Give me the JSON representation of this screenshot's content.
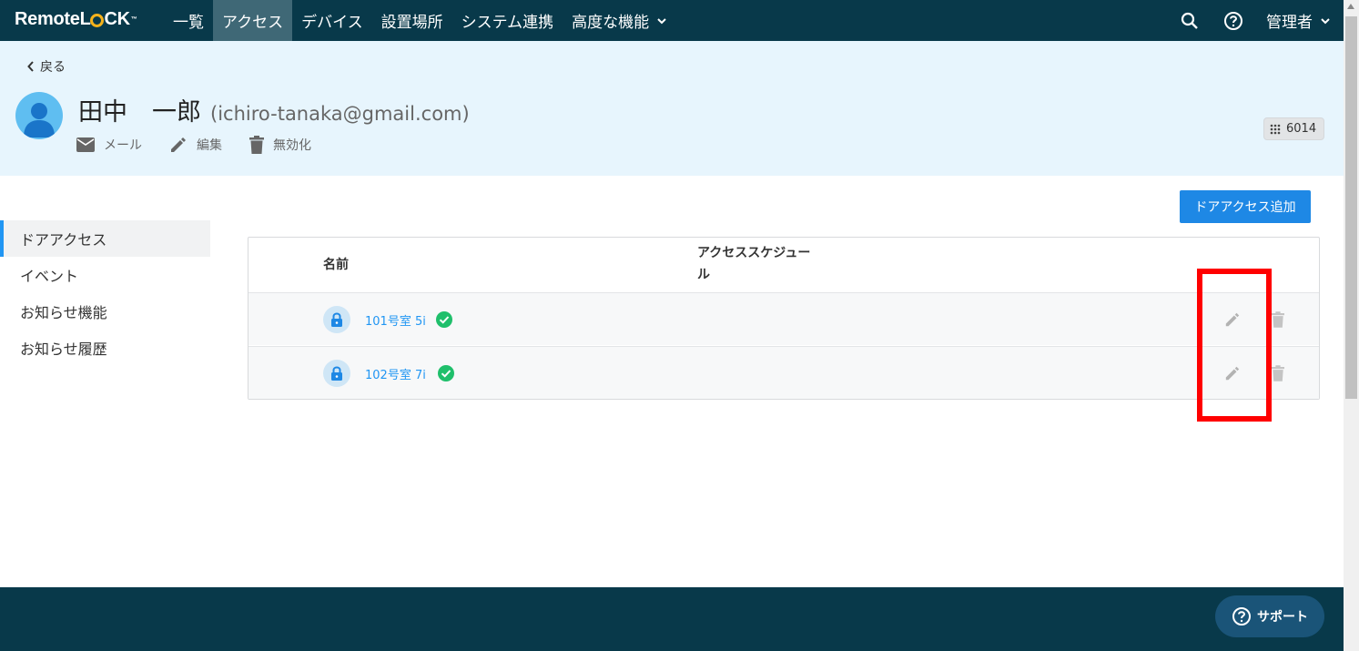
{
  "brand": {
    "logo_remote": "Remote",
    "logo_l": "L",
    "logo_ck": "CK",
    "logo_tm": "™"
  },
  "nav": {
    "items": [
      {
        "label": "一覧",
        "active": false
      },
      {
        "label": "アクセス",
        "active": true
      },
      {
        "label": "デバイス",
        "active": false
      },
      {
        "label": "設置場所",
        "active": false
      },
      {
        "label": "システム連携",
        "active": false
      },
      {
        "label": "高度な機能",
        "active": false
      }
    ],
    "user_label": "管理者",
    "icons": [
      "search-icon",
      "help-icon",
      "chevron-down-icon"
    ]
  },
  "header": {
    "back_label": "戻る",
    "name": "田中　一郎",
    "email": "(ichiro-tanaka@gmail.com)",
    "actions": {
      "mail": "メール",
      "edit": "編集",
      "disable": "無効化"
    },
    "pin": "6014"
  },
  "sidebar": {
    "items": [
      {
        "label": "ドアアクセス",
        "active": true
      },
      {
        "label": "イベント",
        "active": false
      },
      {
        "label": "お知らせ機能",
        "active": false
      },
      {
        "label": "お知らせ履歴",
        "active": false
      }
    ]
  },
  "main": {
    "add_button": "ドアアクセス追加",
    "columns": {
      "name": "名前",
      "schedule_line1": "アクセススケジュー",
      "schedule_line2": "ル"
    },
    "rows": [
      {
        "name": "101号室 5i",
        "status": "ok"
      },
      {
        "name": "102号室 7i",
        "status": "ok"
      }
    ]
  },
  "footer": {
    "support_label": "サポート"
  },
  "colors": {
    "nav_bg": "#08394a",
    "header_bg": "#e7f5fd",
    "accent": "#1e88e5",
    "check": "#1fbf6b",
    "highlight": "#ff0000"
  }
}
